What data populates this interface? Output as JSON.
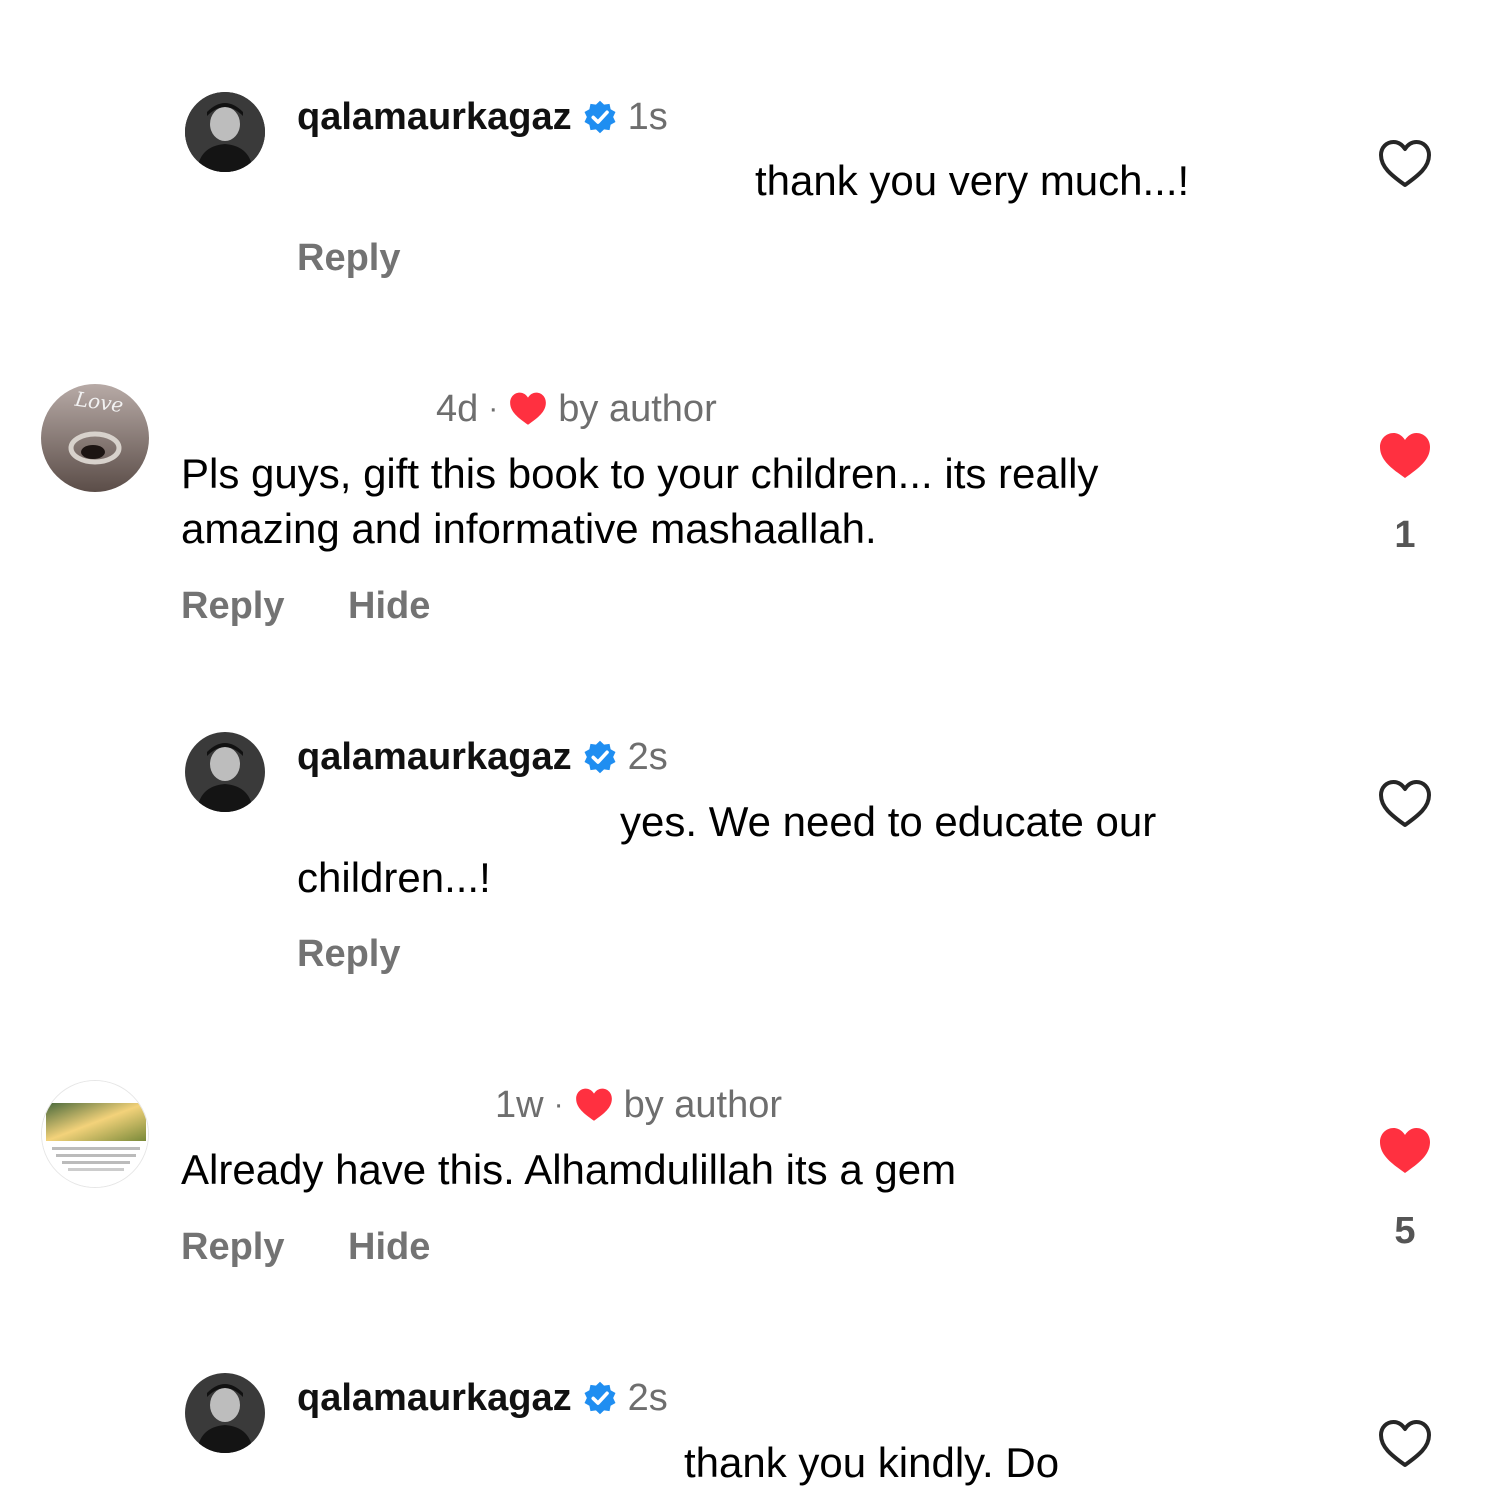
{
  "colors": {
    "verified_blue": "#1f8ef1",
    "like_red": "#ff3040",
    "muted": "#737373"
  },
  "actions": {
    "reply": "Reply",
    "hide": "Hide",
    "liked_by_author": "by author",
    "dot": "·"
  },
  "comments": [
    {
      "type": "reply",
      "username": "qalamaurkagaz",
      "verified": true,
      "time": "1s",
      "text": "thank you very much...!",
      "liked": false,
      "like_count": null,
      "icon": "heart-outline-icon"
    },
    {
      "type": "comment",
      "username": "",
      "time": "4d",
      "liked_by_author": true,
      "avatar_text": "Love",
      "text_lines": [
        "Pls guys, gift this book to your children... its really",
        "amazing and informative mashaallah."
      ],
      "liked": true,
      "like_count": "1",
      "icon": "heart-filled-icon"
    },
    {
      "type": "reply",
      "username": "qalamaurkagaz",
      "verified": true,
      "time": "2s",
      "text_lines": [
        "yes. We need to educate our",
        "children...!"
      ],
      "liked": false,
      "like_count": null,
      "icon": "heart-outline-icon"
    },
    {
      "type": "comment",
      "username": "",
      "time": "1w",
      "liked_by_author": true,
      "text": "Already have this. Alhamdulillah its a gem",
      "liked": true,
      "like_count": "5",
      "icon": "heart-filled-icon"
    },
    {
      "type": "reply",
      "username": "qalamaurkagaz",
      "verified": true,
      "time": "2s",
      "text": "thank you kindly. Do",
      "liked": false,
      "like_count": null,
      "icon": "heart-outline-icon"
    }
  ]
}
